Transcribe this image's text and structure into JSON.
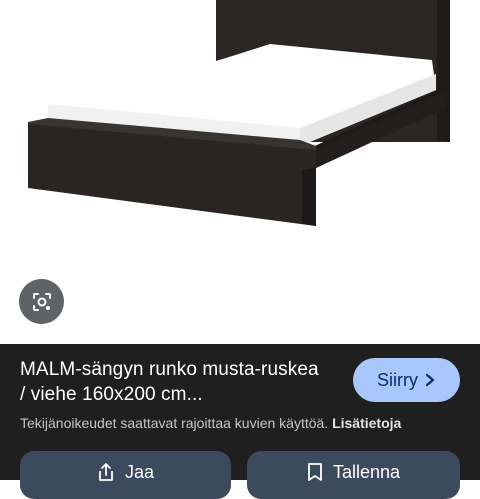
{
  "result": {
    "title": "MALM-sängyn runko musta-ruskea / viehe 160x200 cm...",
    "visit_button": {
      "label": "Siirry",
      "icon": "chevron-right-icon"
    },
    "copyright_notice": "Tekijänoikeudet saattavat rajoittaa kuvien käyttöä.",
    "learn_more_link": "Lisätietoja"
  },
  "actions": {
    "share": {
      "label": "Jaa",
      "icon": "share-icon"
    },
    "save": {
      "label": "Tallenna",
      "icon": "bookmark-icon"
    }
  },
  "lens_button": {
    "icon": "lens-search-icon"
  },
  "colors": {
    "panel_bg": "#1f1f1f",
    "visit_button_bg": "#a8c7fa",
    "action_button_bg": "#3c4a5e",
    "bed_frame": "#2a2523"
  }
}
